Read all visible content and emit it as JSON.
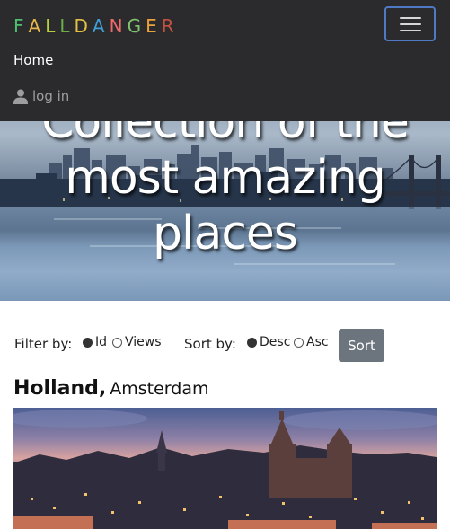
{
  "brand": {
    "letters": [
      "F",
      "A",
      "L",
      "L",
      "D",
      "A",
      "N",
      "G",
      "E",
      "R"
    ],
    "colors": [
      "#4cc06f",
      "#e6b94a",
      "#b8cf3c",
      "#6ab04a",
      "#e4c144",
      "#3f9fd6",
      "#ec6a6a",
      "#7fc36f",
      "#e9a23b",
      "#c0523f"
    ]
  },
  "nav": {
    "home": "Home",
    "login": "log in"
  },
  "hero": {
    "line1": "Collection of the",
    "line2": "most amazing",
    "line3": "places"
  },
  "filter": {
    "filter_label": "Filter by:",
    "options": [
      {
        "label": "Id",
        "checked": true
      },
      {
        "label": "Views",
        "checked": false
      }
    ],
    "sort_label": "Sort by:",
    "sort_options": [
      {
        "label": "Desc",
        "checked": true
      },
      {
        "label": "Asc",
        "checked": false
      }
    ],
    "sort_button": "Sort"
  },
  "place": {
    "country": "Holland,",
    "city": "Amsterdam"
  },
  "colors": {
    "navbar": "#2b2a2d",
    "sort_button": "#6c757d",
    "toggler_border": "#4f79c4"
  }
}
